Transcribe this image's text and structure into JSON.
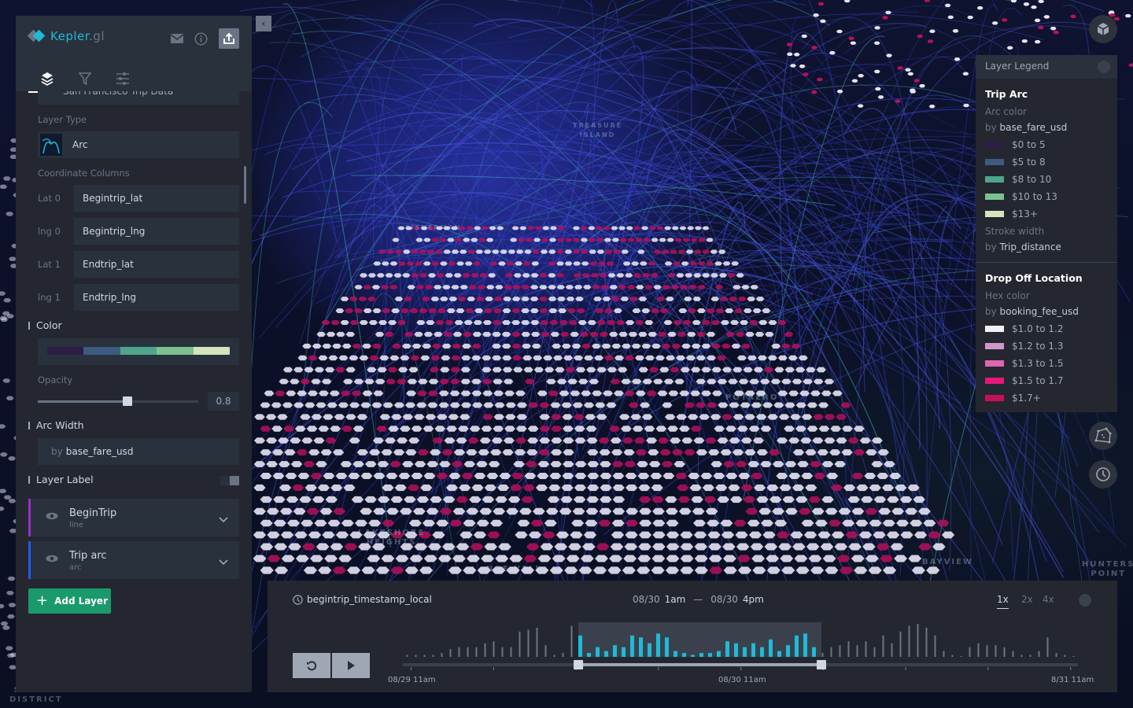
{
  "app": {
    "name": "Kepler",
    "name_suffix": ".gl"
  },
  "header": {
    "icons": [
      "mail-icon",
      "info-icon",
      "share-icon"
    ]
  },
  "tabs": [
    {
      "name": "layers",
      "icon": "layers-icon",
      "active": true
    },
    {
      "name": "filters",
      "icon": "filter-icon",
      "active": false
    },
    {
      "name": "interactions",
      "icon": "sliders-icon",
      "active": false
    }
  ],
  "layer_config": {
    "dataset": "San Francisco Trip Data",
    "dataset_color": "#1b5cff",
    "layer_type_label": "Layer Type",
    "layer_type": "Arc",
    "coordinate_columns_label": "Coordinate Columns",
    "columns": [
      {
        "label": "Lat 0",
        "value": "Begintrip_lat"
      },
      {
        "label": "lng 0",
        "value": "Begintrip_lng"
      },
      {
        "label": "Lat 1",
        "value": "Endtrip_lat"
      },
      {
        "label": "lng 1",
        "value": "Endtrip_lng"
      }
    ],
    "color_section": "Color",
    "color_range": [
      "#2e1d45",
      "#3d5a80",
      "#4fa58b",
      "#7cc18f",
      "#d4e4bc"
    ],
    "opacity_label": "Opacity",
    "opacity_value": "0.8",
    "opacity": 0.8,
    "arc_width_section": "Arc Width",
    "arc_width_by": "by",
    "arc_width_field": "base_fare_usd",
    "layer_label_section": "Layer Label",
    "layer_label_enabled": false
  },
  "layers": [
    {
      "name": "BeginTrip",
      "type": "line",
      "color": "#9b2fc9"
    },
    {
      "name": "Trip arc",
      "type": "arc",
      "color": "#1b5cff"
    }
  ],
  "add_layer_label": "Add Layer",
  "legend": {
    "title": "Layer Legend",
    "sections": [
      {
        "layer": "Trip Arc",
        "color_label": "Arc color",
        "by": "by",
        "color_field": "base_fare_usd",
        "items": [
          {
            "label": "$0 to 5",
            "color": "#2e1d45"
          },
          {
            "label": "$5 to 8",
            "color": "#3d5a80"
          },
          {
            "label": "$8 to 10",
            "color": "#4fa58b"
          },
          {
            "label": "$10 to 13",
            "color": "#7cc18f"
          },
          {
            "label": "$13+",
            "color": "#d4e4bc"
          }
        ],
        "stroke_label": "Stroke width",
        "stroke_field": "Trip_distance"
      },
      {
        "layer": "Drop Off Location",
        "color_label": "Hex color",
        "by": "by",
        "color_field": "booking_fee_usd",
        "items": [
          {
            "label": "$1.0 to 1.2",
            "color": "#f3f0f7"
          },
          {
            "label": "$1.2 to 1.3",
            "color": "#cf97c9"
          },
          {
            "label": "$1.3 to 1.5",
            "color": "#e066b0"
          },
          {
            "label": "$1.5 to 1.7",
            "color": "#e0197a"
          },
          {
            "label": "$1.7+",
            "color": "#c4105a"
          }
        ]
      }
    ]
  },
  "map_labels": [
    {
      "text": "TREASURE\nISLAND"
    },
    {
      "text": "LAKESHORE\nHEIGHTS"
    },
    {
      "text": "BAYVIEW"
    },
    {
      "text": "HUNTERS\nPOINT"
    },
    {
      "text": "SUNSET\nDISTRICT"
    },
    {
      "text": "FISHERMAN"
    },
    {
      "text": "NOE VALL"
    },
    {
      "text": "POTRERO"
    }
  ],
  "timeline": {
    "field": "begintrip_timestamp_local",
    "range_start_date": "08/30",
    "range_start_time": "1am",
    "range_sep": "—",
    "range_end_date": "08/30",
    "range_end_time": "4pm",
    "speeds": [
      "1x",
      "2x",
      "4x"
    ],
    "active_speed": "1x",
    "tick_labels": [
      "08/29 11am",
      "08/30 11am",
      "8/31 11am"
    ],
    "selected_fraction": [
      0.26,
      0.62
    ],
    "histogram": [
      1,
      1,
      1,
      1,
      2,
      4,
      5,
      5,
      5,
      7,
      8,
      5,
      5,
      13,
      14,
      15,
      6,
      1,
      2,
      16,
      11,
      2,
      5,
      3,
      6,
      5,
      11,
      10,
      7,
      12,
      10,
      3,
      2,
      1,
      2,
      2,
      3,
      8,
      7,
      5,
      7,
      5,
      9,
      3,
      6,
      11,
      12,
      5,
      2,
      5,
      6,
      8,
      6,
      8,
      5,
      11,
      7,
      13,
      16,
      17,
      15,
      11,
      3,
      1,
      0,
      5,
      7,
      6,
      6,
      5,
      3,
      1,
      1,
      3,
      10,
      2,
      1,
      0
    ],
    "selected_color": "#1fbad6",
    "unselected_color": "#6a7485"
  },
  "map_buttons": [
    "3d-view-icon",
    "draw-polygon-icon",
    "clock-icon"
  ],
  "legend_colors": {
    "hex_light": "#e6e4f5",
    "hex_dark": "#b5115e"
  }
}
